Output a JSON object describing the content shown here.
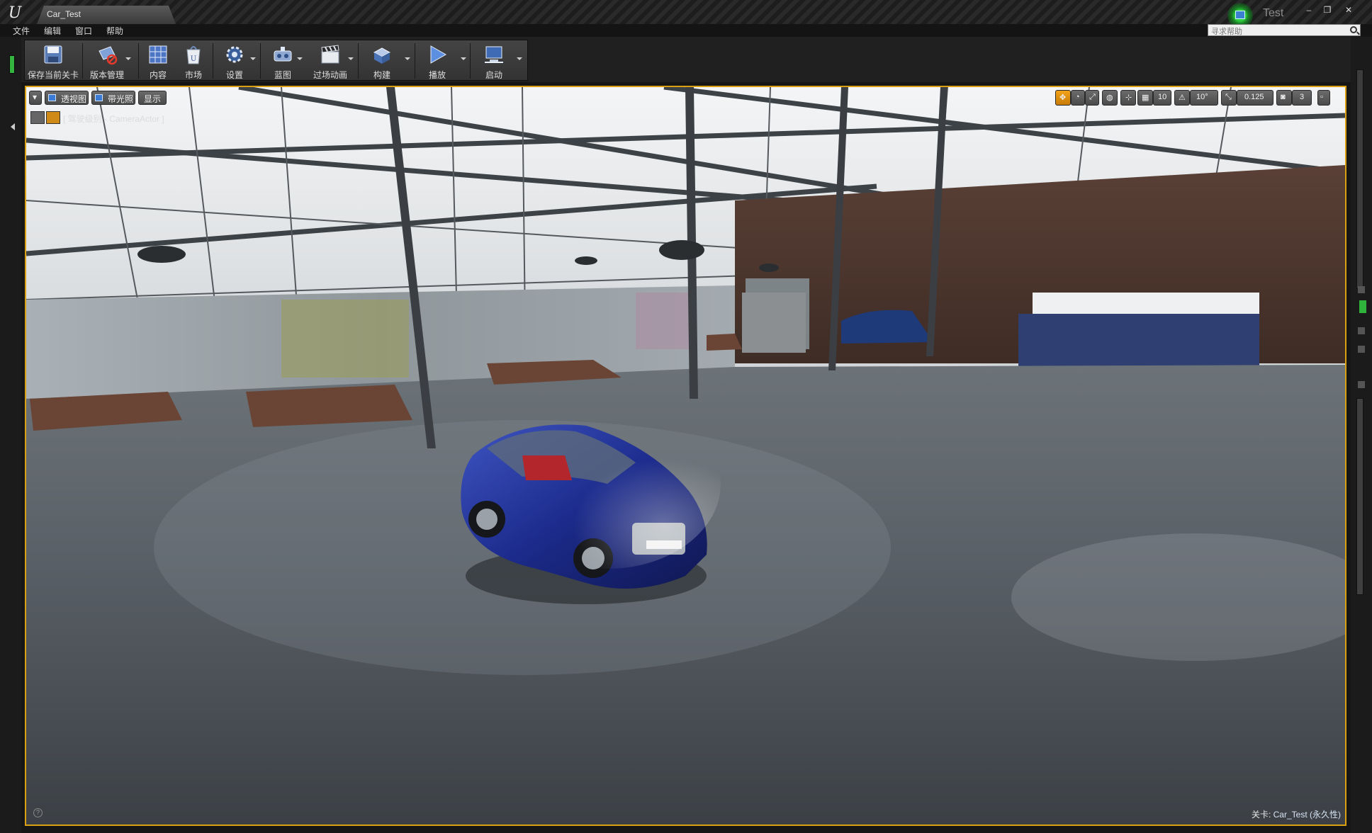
{
  "window": {
    "tab_title": "Car_Test",
    "project_name": "Test",
    "controls": {
      "minimize": "–",
      "restore": "❐",
      "close": "✕"
    }
  },
  "menu": {
    "items": [
      "文件",
      "编辑",
      "窗口",
      "帮助"
    ],
    "help_search_placeholder": "寻求帮助"
  },
  "toolbar": {
    "buttons": [
      {
        "label": "保存当前关卡",
        "icon": "save-icon"
      },
      {
        "label": "版本管理",
        "icon": "source-control-icon",
        "has_dropdown": true
      },
      {
        "label": "内容",
        "icon": "content-browser-icon"
      },
      {
        "label": "市场",
        "icon": "marketplace-icon"
      },
      {
        "label": "设置",
        "icon": "settings-icon",
        "has_dropdown": true
      },
      {
        "label": "蓝图",
        "icon": "blueprint-icon",
        "has_dropdown": true
      },
      {
        "label": "过场动画",
        "icon": "cinematics-icon",
        "has_dropdown": true
      },
      {
        "label": "构建",
        "icon": "build-icon",
        "has_dropdown": true
      },
      {
        "label": "播放",
        "icon": "play-icon",
        "has_dropdown": true
      },
      {
        "label": "启动",
        "icon": "launch-icon",
        "has_dropdown": true
      }
    ]
  },
  "viewport": {
    "view_mode": "透视图",
    "lighting_mode": "带光照",
    "show_label": "显示",
    "pilot_text": "[ 驾驶级别 - CameraActor ]",
    "grid_snap": "10",
    "rotation_snap": "10°",
    "scale_snap": "0.125",
    "camera_speed": "3",
    "level_label_prefix": "关卡:",
    "level_name": "Car_Test (永久性)",
    "accent_color": "#d9a012"
  }
}
